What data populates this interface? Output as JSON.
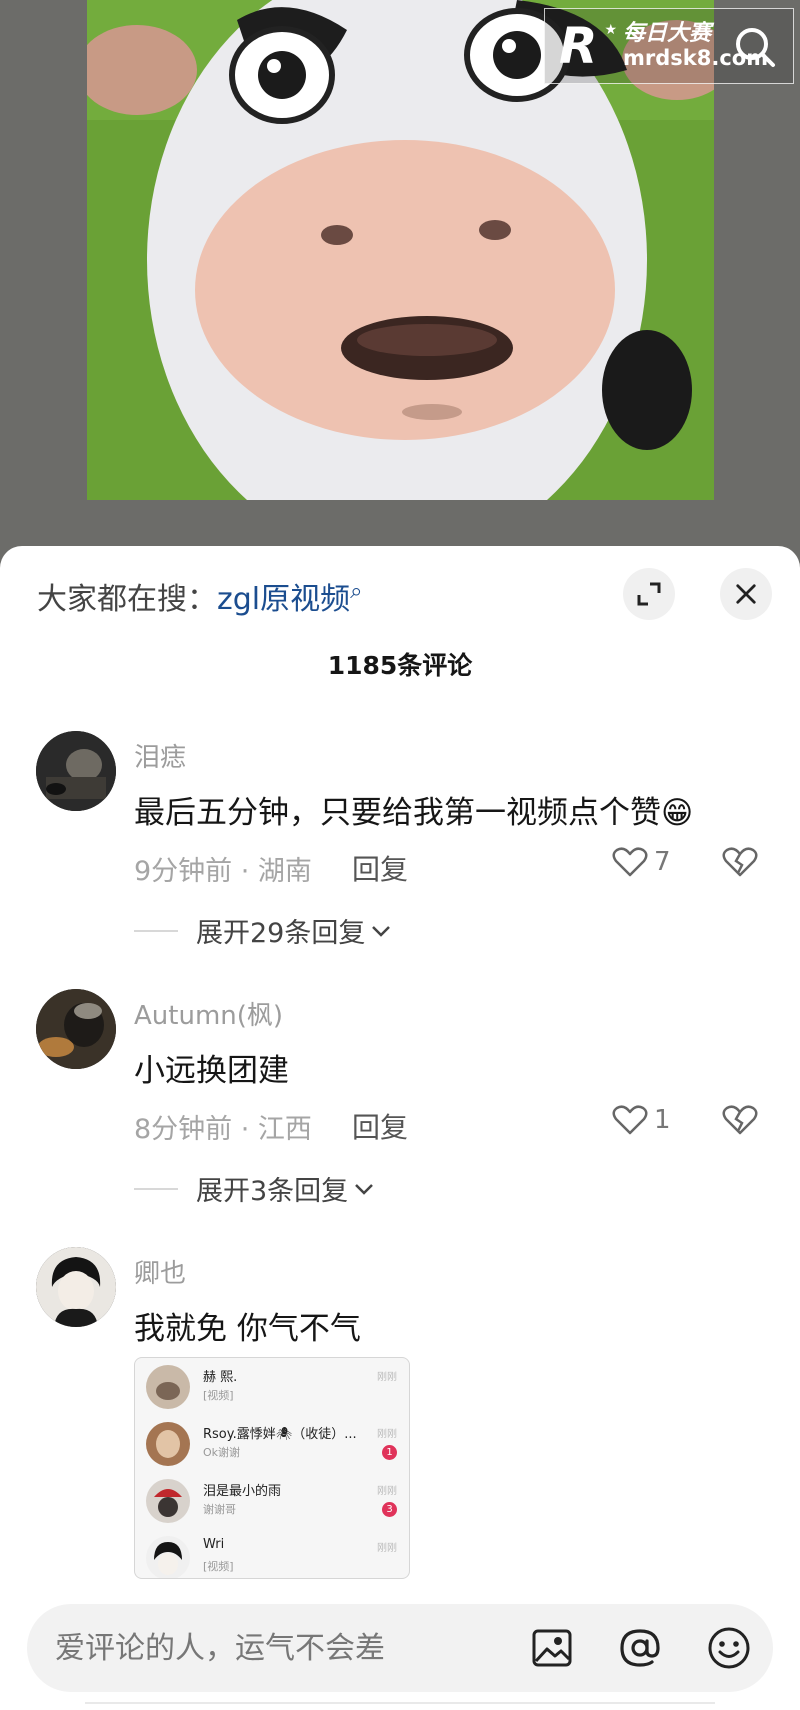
{
  "watermark": {
    "logo_letter": "R",
    "cn_text": "每日大赛",
    "en_text": "mrdsk8.com"
  },
  "comments_panel": {
    "hot_search_prefix": "大家都在搜：",
    "hot_search_keyword": "zgl原视频",
    "count_title": "1185条评论"
  },
  "comments": [
    {
      "user": "泪痣",
      "text": "最后五分钟，只要给我第一视频点个赞😁",
      "meta": "9分钟前 · 湖南",
      "reply_label": "回复",
      "likes": "7",
      "expand_label": "展开29条回复"
    },
    {
      "user": "Autumn(枫)",
      "text": "小远换团建",
      "meta": "8分钟前 · 江西",
      "reply_label": "回复",
      "likes": "1",
      "expand_label": "展开3条回复"
    },
    {
      "user": "卿也",
      "text": "我就免 你气不气",
      "embedded_chat": [
        {
          "name": "赫 熙.",
          "sub": "[视频]",
          "time": "刚刚",
          "badge": ""
        },
        {
          "name": "Rsoy.露悸姅🕷（收徒）...",
          "sub": "Ok谢谢",
          "time": "刚刚",
          "badge": "1"
        },
        {
          "name": "泪是最小的雨",
          "sub": "谢谢哥",
          "time": "刚刚",
          "badge": "3"
        },
        {
          "name": "Wri",
          "sub": "[视频]",
          "time": "刚刚",
          "badge": ""
        }
      ]
    }
  ],
  "input": {
    "placeholder": "爱评论的人，运气不会差"
  },
  "icons": {
    "watermark_search": "search-icon",
    "expand": "expand-icon",
    "close": "close-icon",
    "like": "heart-icon",
    "dislike": "broken-heart-icon",
    "chevron": "chevron-down-icon",
    "image": "image-icon",
    "mention": "at-icon",
    "emoji": "smile-icon"
  },
  "colors": {
    "keyword": "#1b4d8f",
    "badge": "#e0335a"
  }
}
